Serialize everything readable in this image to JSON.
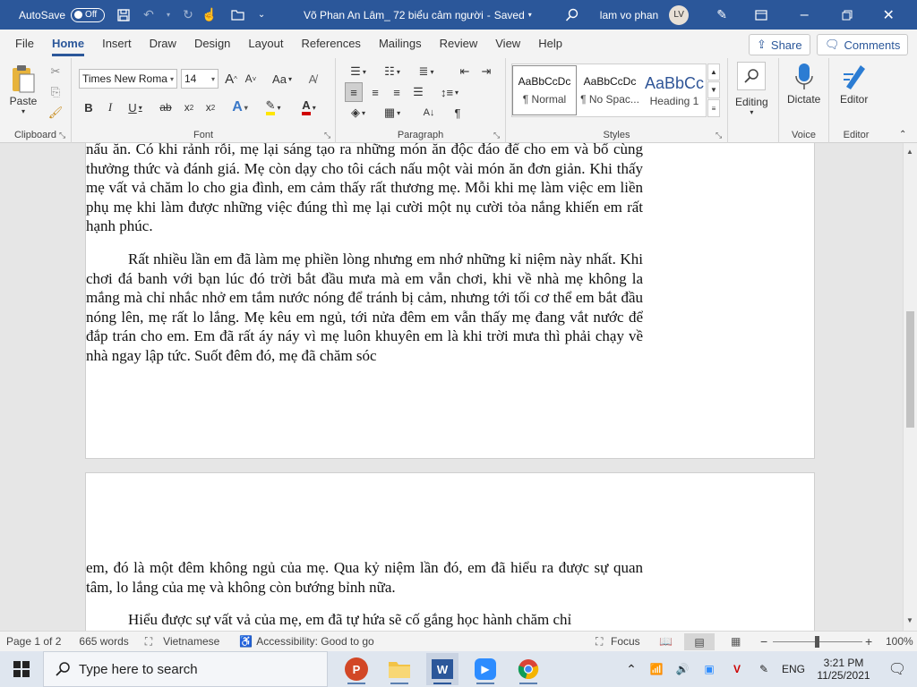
{
  "titlebar": {
    "autosave_label": "AutoSave",
    "autosave_state": "Off",
    "doc_title": "Võ Phan An Lâm_ 72 biểu cảm người",
    "saved_status": "Saved",
    "user_name": "lam vo phan",
    "user_initials": "LV"
  },
  "tabs": [
    "File",
    "Home",
    "Insert",
    "Draw",
    "Design",
    "Layout",
    "References",
    "Mailings",
    "Review",
    "View",
    "Help"
  ],
  "share_label": "Share",
  "comments_label": "Comments",
  "ribbon": {
    "clipboard": {
      "paste_label": "Paste",
      "group_label": "Clipboard"
    },
    "font": {
      "font_name": "Times New Roma",
      "font_size": "14",
      "group_label": "Font",
      "aa_label": "Aa",
      "grow_label": "A",
      "shrink_label": "A"
    },
    "paragraph": {
      "group_label": "Paragraph"
    },
    "styles": {
      "group_label": "Styles",
      "items": [
        {
          "preview": "AaBbCcDc",
          "name": "¶ Normal"
        },
        {
          "preview": "AaBbCcDc",
          "name": "¶ No Spac..."
        },
        {
          "preview": "AaBbCc",
          "name": "Heading 1"
        }
      ]
    },
    "editing_label": "Editing",
    "dictate_label": "Dictate",
    "voice_group": "Voice",
    "editor_label": "Editor",
    "editor_group": "Editor"
  },
  "document": {
    "page1_para1": "nấu ăn. Có khi rảnh rỗi, mẹ lại sáng tạo ra những món ăn độc đáo để cho em và bố cùng thưởng thức và đánh giá. Mẹ còn dạy cho tôi cách nấu một vài món ăn đơn giản. Khi thấy mẹ vất vả chăm lo cho gia đình, em cảm thấy rất thương mẹ. Mỗi khi mẹ làm việc em liền phụ mẹ khi làm được những việc đúng thì mẹ lại cười một nụ cười tỏa nắng khiến em rất hạnh phúc.",
    "page1_para2": "Rất nhiều lần em đã làm mẹ phiền lòng nhưng em nhớ những kỉ niệm này nhất. Khi chơi đá banh với bạn lúc đó trời bắt đầu mưa mà em vẫn chơi, khi về nhà mẹ không la mắng mà chỉ nhắc nhở em tắm nước nóng để tránh bị cảm, nhưng tới tối cơ thể em bắt đầu nóng lên, mẹ rất lo lắng. Mẹ kêu em ngủ, tới nửa đêm em vẫn thấy mẹ đang vắt nước để đắp trán cho em. Em đã rất áy náy vì mẹ luôn khuyên em là khi trời mưa thì phải chạy về nhà ngay lập tức. Suốt đêm đó, mẹ đã chăm sóc",
    "page2_para1": "em, đó là một đêm không ngủ của mẹ. Qua kỷ niệm lần đó, em đã hiểu ra được sự quan tâm, lo lắng của mẹ và không còn bướng bỉnh nữa.",
    "page2_para2": "Hiểu được sự vất vả của mẹ, em đã tự hứa sẽ cố gắng học hành chăm chỉ"
  },
  "status": {
    "page": "Page 1 of 2",
    "words": "665 words",
    "language": "Vietnamese",
    "accessibility": "Accessibility: Good to go",
    "focus": "Focus",
    "zoom": "100%"
  },
  "taskbar": {
    "search_placeholder": "Type here to search",
    "lang": "ENG",
    "time": "3:21 PM",
    "date": "11/25/2021"
  },
  "colors": {
    "word_blue": "#2b579a"
  },
  "icons": [
    "save-icon",
    "undo-icon",
    "redo-icon",
    "touch-icon",
    "open-icon",
    "search-icon",
    "pen-icon",
    "restore-icon",
    "minimize-icon",
    "close-icon",
    "windows-icon"
  ]
}
